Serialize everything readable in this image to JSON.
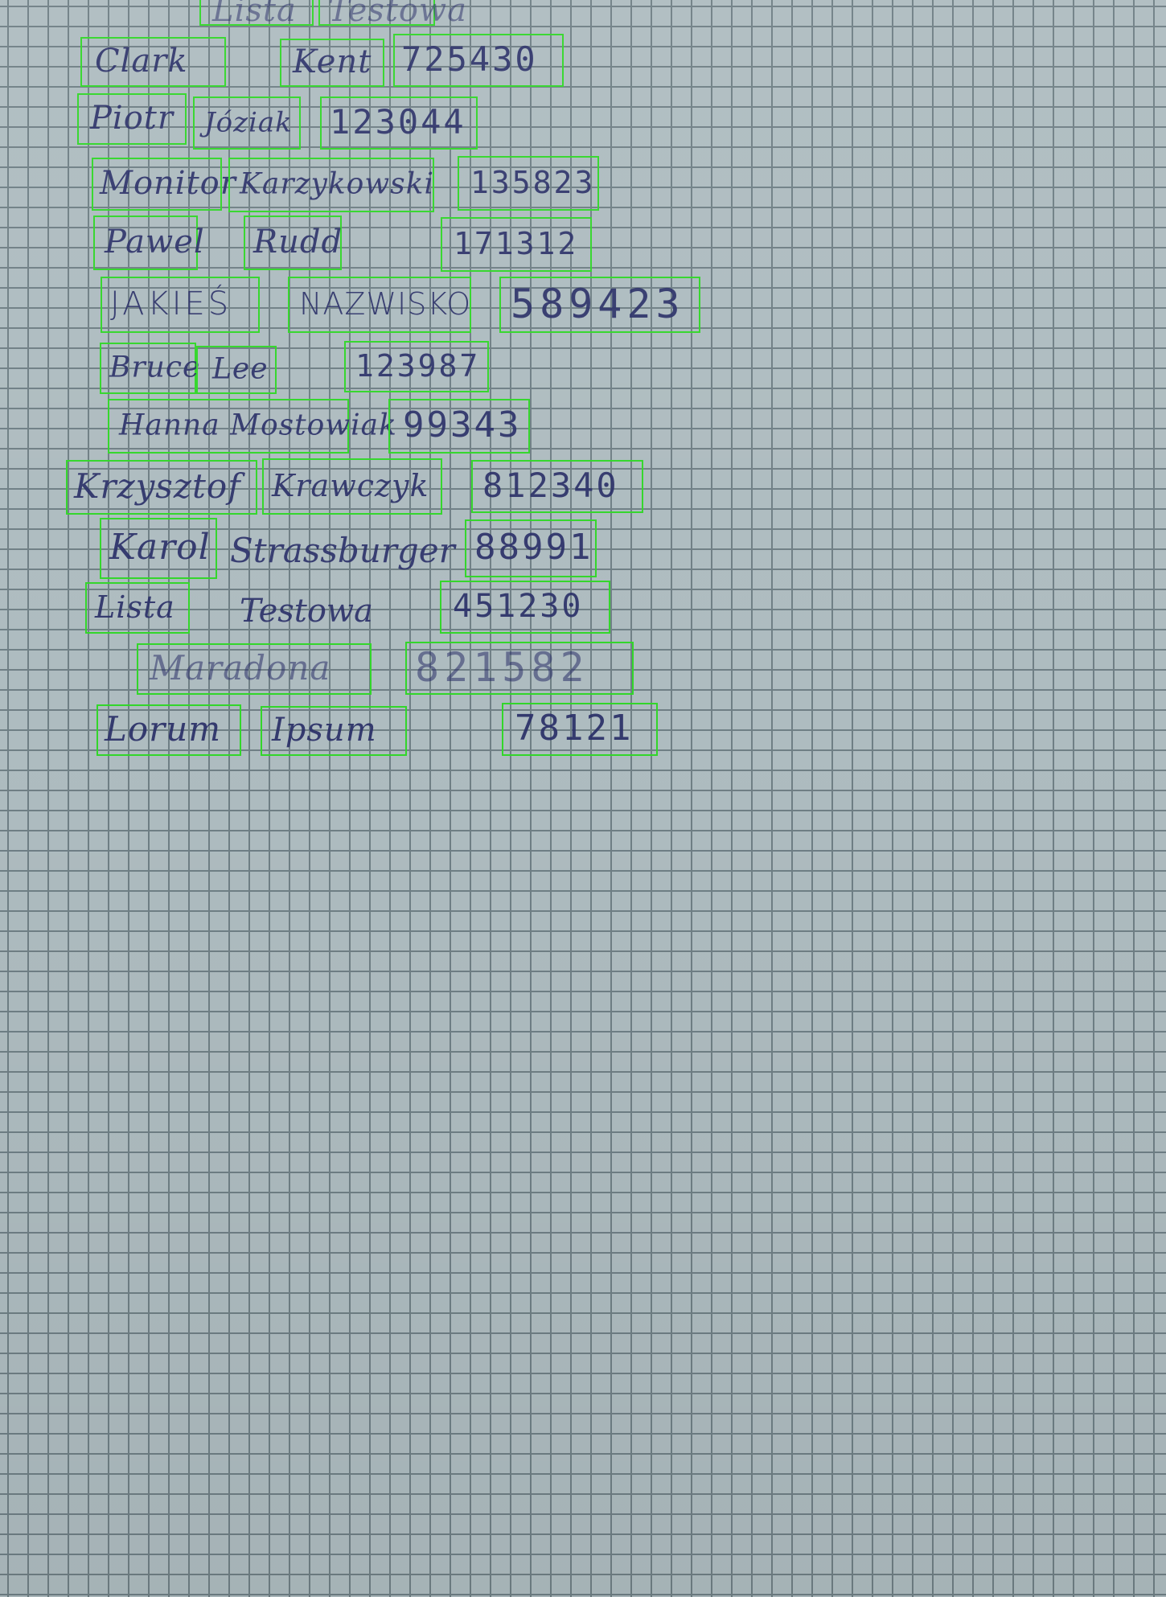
{
  "colors": {
    "paper": "#aebcc0",
    "grid": "#6f7f85",
    "ink": "#2a2f68",
    "box": "#32d62a"
  },
  "rows": [
    {
      "first": "Lista",
      "last": "Testowa",
      "number": ""
    },
    {
      "first": "Clark",
      "last": "Kent",
      "number": "725430"
    },
    {
      "first": "Piotr",
      "last": "Józiak",
      "number": "123044"
    },
    {
      "first": "Monitor",
      "last": "Karzykowski",
      "number": "135823"
    },
    {
      "first": "Pawel",
      "last": "Rudd",
      "number": "171312"
    },
    {
      "first": "JAKIEŚ",
      "last": "NAZWISKO",
      "number": "589423"
    },
    {
      "first": "Bruce",
      "last": "Lee",
      "number": "123987"
    },
    {
      "first": "Hanna Mostowiak",
      "last": "",
      "number": "99343"
    },
    {
      "first": "Krzysztof",
      "last": "Krawczyk",
      "number": "812340"
    },
    {
      "first": "Karol",
      "last": "Strassburger",
      "number": "88991"
    },
    {
      "first": "Lista",
      "last": "Testowa",
      "number": "451230"
    },
    {
      "first": "Maradona",
      "last": "",
      "number": "821582"
    },
    {
      "first": "Lorum",
      "last": "Ipsum",
      "number": "78121"
    }
  ]
}
